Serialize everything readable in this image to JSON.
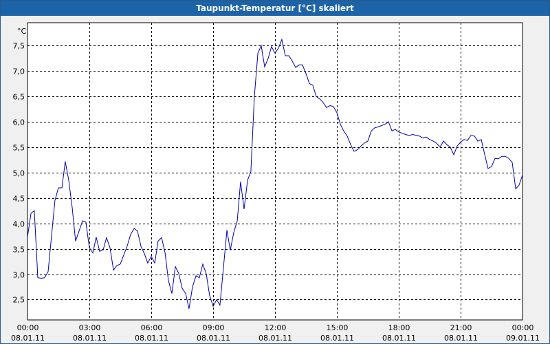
{
  "window": {
    "title": "Taupunkt-Temperatur [°C] skaliert"
  },
  "colors": {
    "line": "#0000aa",
    "grid": "#000000",
    "titlebar": "#1c63a8",
    "plot_bg": "#ffffff"
  },
  "chart_data": {
    "type": "line",
    "title": "Taupunkt-Temperatur [°C] skaliert",
    "yunit": "°C",
    "xlabel": "",
    "ylabel": "°C",
    "ylim": [
      2.1,
      7.95
    ],
    "xlim_hours": [
      0,
      24
    ],
    "grid": true,
    "y_ticks": [
      "2,5",
      "3,0",
      "3,5",
      "4,0",
      "4,5",
      "5,0",
      "5,5",
      "6,0",
      "6,5",
      "7,0",
      "7,5"
    ],
    "x_ticks": [
      {
        "time": "00:00",
        "date": "08.01.11"
      },
      {
        "time": "03:00",
        "date": "08.01.11"
      },
      {
        "time": "06:00",
        "date": "08.01.11"
      },
      {
        "time": "09:00",
        "date": "08.01.11"
      },
      {
        "time": "12:00",
        "date": "08.01.11"
      },
      {
        "time": "15:00",
        "date": "08.01.11"
      },
      {
        "time": "18:00",
        "date": "08.01.11"
      },
      {
        "time": "21:00",
        "date": "08.01.11"
      },
      {
        "time": "00:00",
        "date": "09.01.11"
      }
    ],
    "series": [
      {
        "values": [
          [
            0.0,
            3.73
          ],
          [
            0.17,
            4.2
          ],
          [
            0.33,
            4.25
          ],
          [
            0.5,
            2.93
          ],
          [
            0.67,
            2.92
          ],
          [
            0.83,
            2.93
          ],
          [
            1.0,
            3.05
          ],
          [
            1.33,
            4.45
          ],
          [
            1.5,
            4.7
          ],
          [
            1.67,
            4.7
          ],
          [
            1.83,
            5.22
          ],
          [
            2.0,
            4.85
          ],
          [
            2.17,
            4.3
          ],
          [
            2.33,
            3.65
          ],
          [
            2.5,
            3.85
          ],
          [
            2.67,
            4.05
          ],
          [
            2.83,
            4.03
          ],
          [
            3.0,
            3.52
          ],
          [
            3.17,
            3.42
          ],
          [
            3.33,
            3.73
          ],
          [
            3.5,
            3.45
          ],
          [
            3.67,
            3.48
          ],
          [
            3.83,
            3.72
          ],
          [
            4.0,
            3.52
          ],
          [
            4.17,
            3.08
          ],
          [
            4.33,
            3.17
          ],
          [
            4.5,
            3.2
          ],
          [
            4.83,
            3.55
          ],
          [
            5.0,
            3.78
          ],
          [
            5.17,
            3.9
          ],
          [
            5.33,
            3.85
          ],
          [
            5.5,
            3.55
          ],
          [
            5.67,
            3.4
          ],
          [
            5.83,
            3.22
          ],
          [
            6.0,
            3.35
          ],
          [
            6.17,
            3.22
          ],
          [
            6.33,
            3.65
          ],
          [
            6.5,
            3.72
          ],
          [
            6.67,
            3.42
          ],
          [
            6.83,
            2.88
          ],
          [
            7.0,
            2.62
          ],
          [
            7.17,
            3.15
          ],
          [
            7.33,
            3.02
          ],
          [
            7.5,
            2.72
          ],
          [
            7.67,
            2.62
          ],
          [
            7.83,
            2.32
          ],
          [
            8.0,
            2.75
          ],
          [
            8.17,
            2.97
          ],
          [
            8.33,
            2.93
          ],
          [
            8.5,
            3.2
          ],
          [
            8.67,
            3.0
          ],
          [
            8.83,
            2.58
          ],
          [
            9.0,
            2.37
          ],
          [
            9.17,
            2.5
          ],
          [
            9.33,
            2.39
          ],
          [
            9.67,
            3.87
          ],
          [
            9.83,
            3.47
          ],
          [
            10.0,
            3.82
          ],
          [
            10.17,
            4.05
          ],
          [
            10.33,
            4.82
          ],
          [
            10.5,
            4.28
          ],
          [
            10.67,
            4.85
          ],
          [
            10.83,
            5.02
          ],
          [
            11.0,
            6.5
          ],
          [
            11.17,
            7.35
          ],
          [
            11.33,
            7.5
          ],
          [
            11.5,
            7.08
          ],
          [
            11.67,
            7.25
          ],
          [
            11.83,
            7.48
          ],
          [
            12.0,
            7.35
          ],
          [
            12.17,
            7.45
          ],
          [
            12.33,
            7.62
          ],
          [
            12.5,
            7.3
          ],
          [
            12.67,
            7.3
          ],
          [
            12.83,
            7.2
          ],
          [
            13.0,
            7.07
          ],
          [
            13.17,
            7.12
          ],
          [
            13.33,
            7.12
          ],
          [
            13.5,
            6.95
          ],
          [
            13.67,
            6.75
          ],
          [
            13.83,
            6.72
          ],
          [
            14.0,
            6.5
          ],
          [
            14.17,
            6.45
          ],
          [
            14.33,
            6.38
          ],
          [
            14.5,
            6.28
          ],
          [
            14.67,
            6.32
          ],
          [
            14.83,
            6.3
          ],
          [
            15.0,
            6.18
          ],
          [
            15.17,
            5.95
          ],
          [
            15.33,
            5.82
          ],
          [
            15.5,
            5.72
          ],
          [
            15.67,
            5.55
          ],
          [
            15.83,
            5.42
          ],
          [
            16.0,
            5.45
          ],
          [
            16.17,
            5.52
          ],
          [
            16.33,
            5.58
          ],
          [
            16.5,
            5.62
          ],
          [
            16.67,
            5.82
          ],
          [
            16.83,
            5.88
          ],
          [
            17.0,
            5.9
          ],
          [
            17.33,
            5.95
          ],
          [
            17.5,
            6.0
          ],
          [
            17.67,
            5.82
          ],
          [
            17.83,
            5.85
          ],
          [
            18.0,
            5.8
          ],
          [
            18.33,
            5.75
          ],
          [
            18.5,
            5.73
          ],
          [
            18.67,
            5.75
          ],
          [
            19.0,
            5.72
          ],
          [
            19.17,
            5.68
          ],
          [
            19.33,
            5.7
          ],
          [
            19.5,
            5.65
          ],
          [
            19.67,
            5.62
          ],
          [
            19.83,
            5.58
          ],
          [
            20.0,
            5.5
          ],
          [
            20.17,
            5.62
          ],
          [
            20.33,
            5.55
          ],
          [
            20.5,
            5.5
          ],
          [
            20.67,
            5.35
          ],
          [
            20.83,
            5.52
          ],
          [
            21.0,
            5.6
          ],
          [
            21.17,
            5.65
          ],
          [
            21.33,
            5.63
          ],
          [
            21.5,
            5.73
          ],
          [
            21.67,
            5.72
          ],
          [
            21.83,
            5.62
          ],
          [
            22.0,
            5.65
          ],
          [
            22.17,
            5.35
          ],
          [
            22.33,
            5.08
          ],
          [
            22.5,
            5.12
          ],
          [
            22.67,
            5.28
          ],
          [
            22.83,
            5.27
          ],
          [
            23.0,
            5.32
          ],
          [
            23.17,
            5.32
          ],
          [
            23.33,
            5.28
          ],
          [
            23.5,
            5.2
          ],
          [
            23.67,
            4.68
          ],
          [
            23.83,
            4.75
          ],
          [
            24.0,
            4.95
          ]
        ]
      }
    ]
  }
}
